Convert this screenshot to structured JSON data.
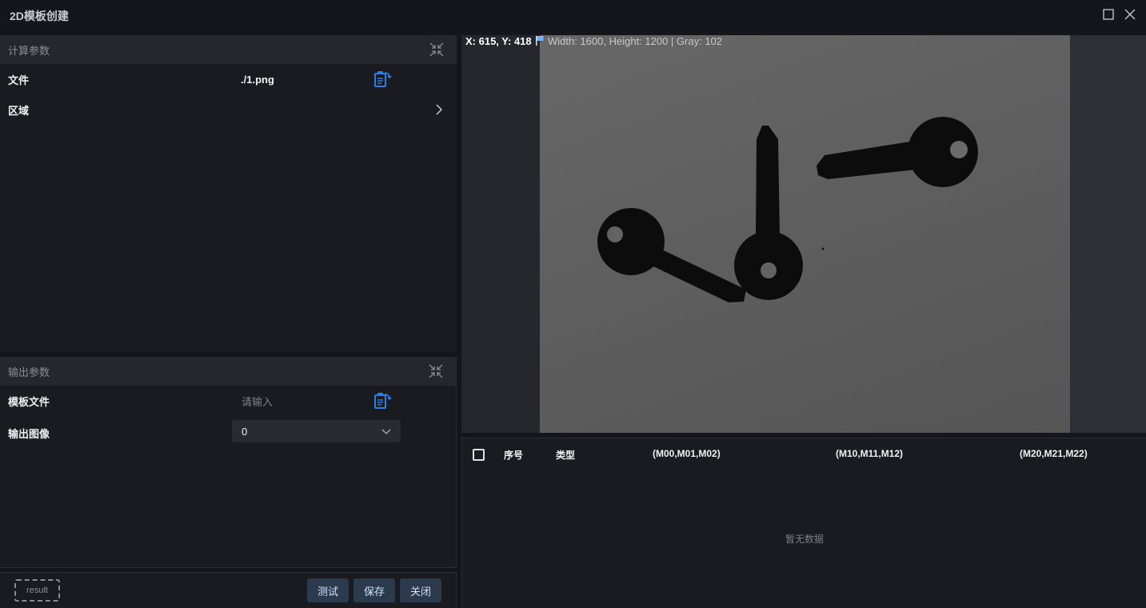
{
  "window": {
    "title": "2D模板创建"
  },
  "calc_section": {
    "title": "计算参数",
    "file_label": "文件",
    "file_value": "./1.png",
    "region_label": "区域"
  },
  "output_section": {
    "title": "输出参数",
    "template_label": "模板文件",
    "template_placeholder": "请输入",
    "output_image_label": "输出图像",
    "output_image_value": "0"
  },
  "footer": {
    "result_label": "result",
    "test_label": "测试",
    "save_label": "保存",
    "close_label": "关闭"
  },
  "viewer": {
    "coord_text": "X: 615, Y: 418",
    "info_text": "Width: 1600, Height: 1200 | Gray: 102"
  },
  "table": {
    "columns": [
      "序号",
      "类型",
      "(M00,M01,M02)",
      "(M10,M11,M12)",
      "(M20,M21,M22)"
    ],
    "empty_text": "暂无数据"
  },
  "colors": {
    "accent_icon": "#2f7fe0",
    "background": "#15161b",
    "panel": "#1a1b21",
    "button": "#2b3a4c"
  }
}
